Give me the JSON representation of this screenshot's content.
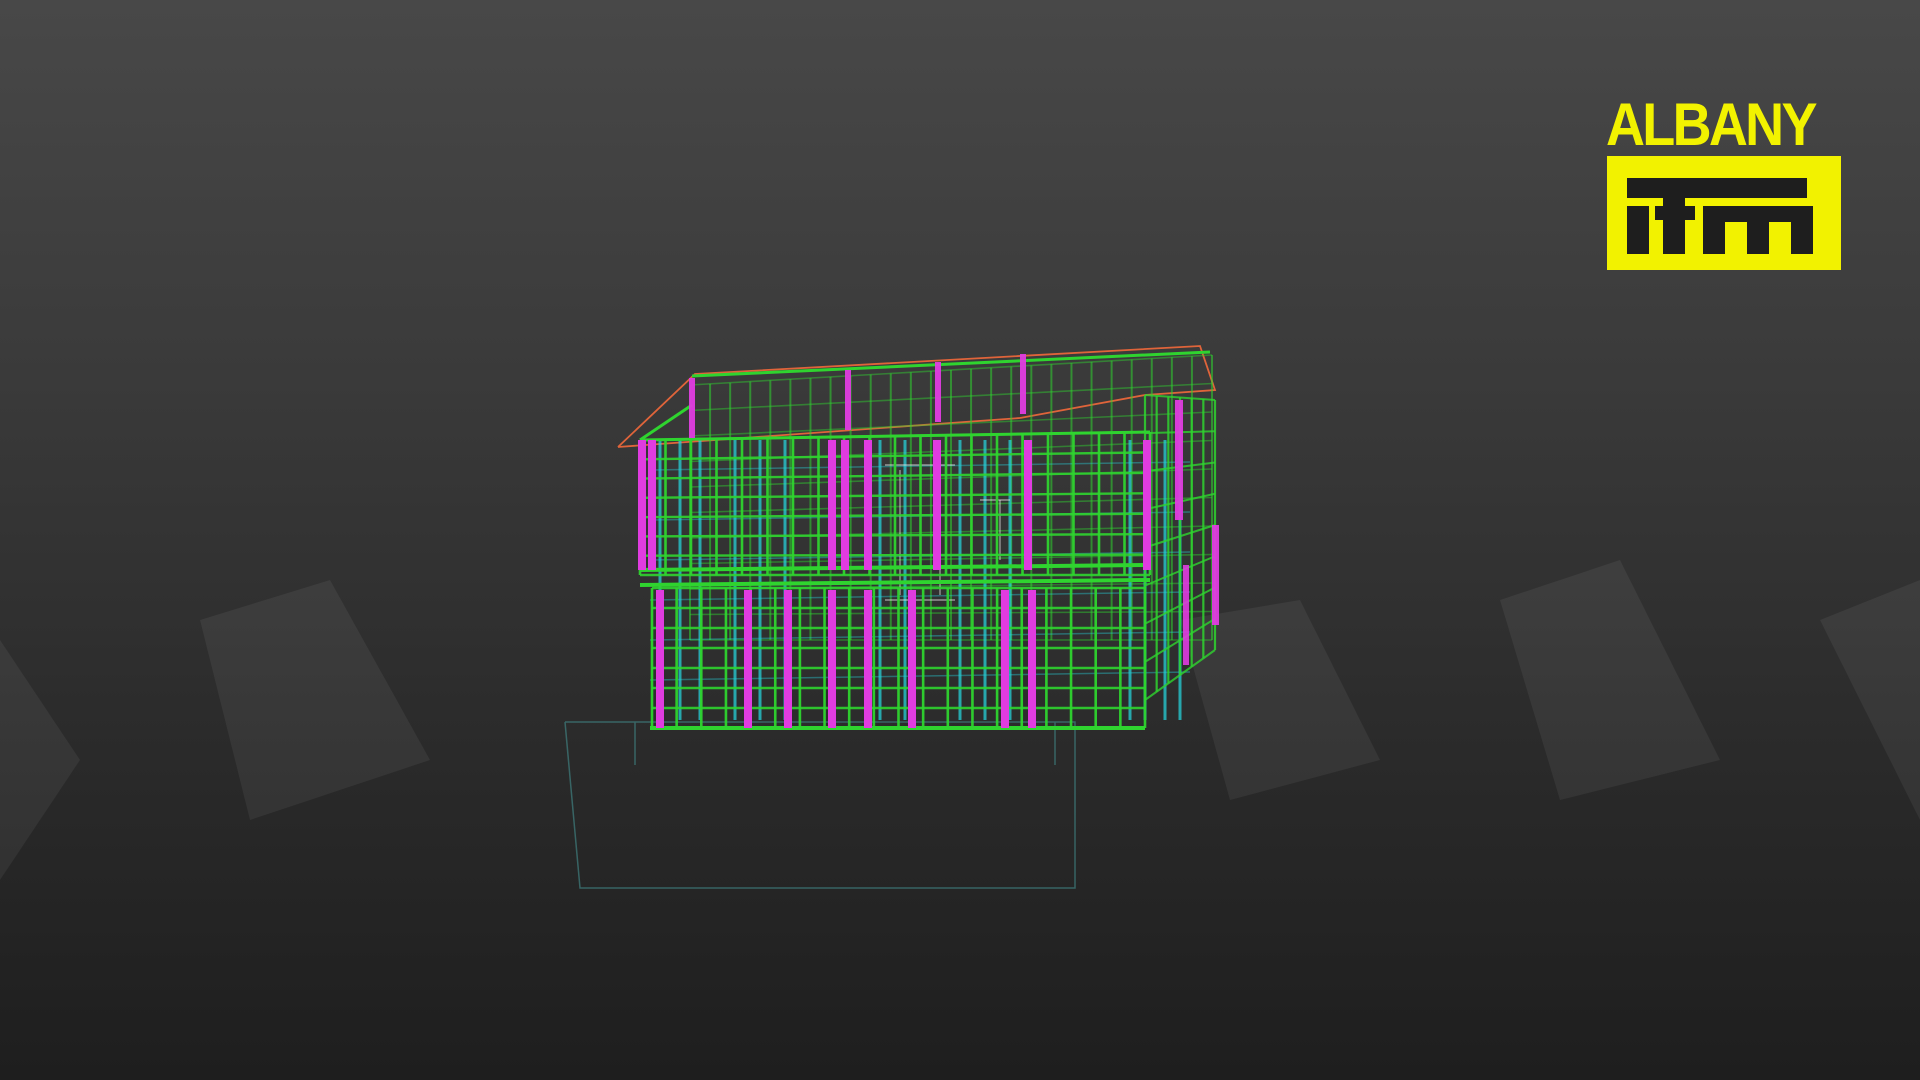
{
  "brand": {
    "name": "ALBANY",
    "mark": "itm",
    "color": "#f2f200"
  },
  "colors": {
    "background_top": "#484848",
    "background_bottom": "#1e1e1e",
    "frame_green": "#2fd42f",
    "stud_magenta": "#e03ce0",
    "inner_cyan": "#26d0d8",
    "roof_orange": "#e0643a",
    "outline_teal": "#3f7f7f"
  },
  "viewport": {
    "model": "timber-frame-house-wireframe",
    "floors": 2
  }
}
